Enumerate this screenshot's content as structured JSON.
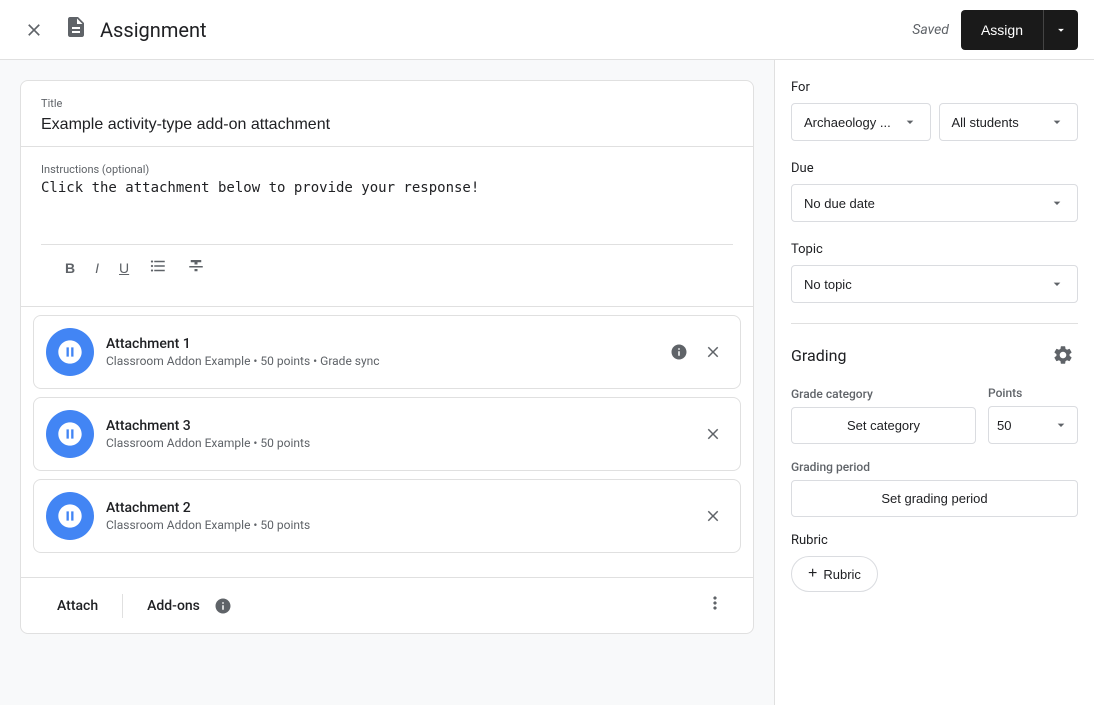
{
  "header": {
    "title": "Assignment",
    "saved_label": "Saved",
    "assign_label": "Assign",
    "close_icon": "×",
    "doc_icon": "📋",
    "chevron_icon": "▾"
  },
  "assignment": {
    "title_label": "Title",
    "title_value": "Example activity-type add-on attachment",
    "instructions_label": "Instructions (optional)",
    "instructions_value": "Click the attachment below to provide your response!",
    "toolbar": {
      "bold": "B",
      "italic": "I",
      "underline": "U",
      "list": "≡",
      "strikethrough": "S̶"
    },
    "attachments": [
      {
        "name": "Attachment 1",
        "meta": "Classroom Addon Example • 50 points • Grade sync"
      },
      {
        "name": "Attachment 3",
        "meta": "Classroom Addon Example • 50 points"
      },
      {
        "name": "Attachment 2",
        "meta": "Classroom Addon Example • 50 points"
      }
    ],
    "bottom_toolbar": {
      "attach_label": "Attach",
      "addons_label": "Add-ons",
      "info_icon": "ℹ",
      "more_icon": "⋮"
    }
  },
  "right_panel": {
    "for_label": "For",
    "class_dropdown": "Archaeology ...",
    "students_dropdown": "All students",
    "due_label": "Due",
    "due_dropdown": "No due date",
    "topic_label": "Topic",
    "topic_dropdown": "No topic",
    "grading": {
      "title": "Grading",
      "gear_icon": "⚙",
      "grade_category_label": "Grade category",
      "points_label": "Points",
      "set_category_label": "Set category",
      "points_value": "50",
      "grading_period_label": "Grading period",
      "set_grading_period_label": "Set grading period",
      "rubric_label": "Rubric",
      "add_rubric_label": "Rubric"
    }
  }
}
